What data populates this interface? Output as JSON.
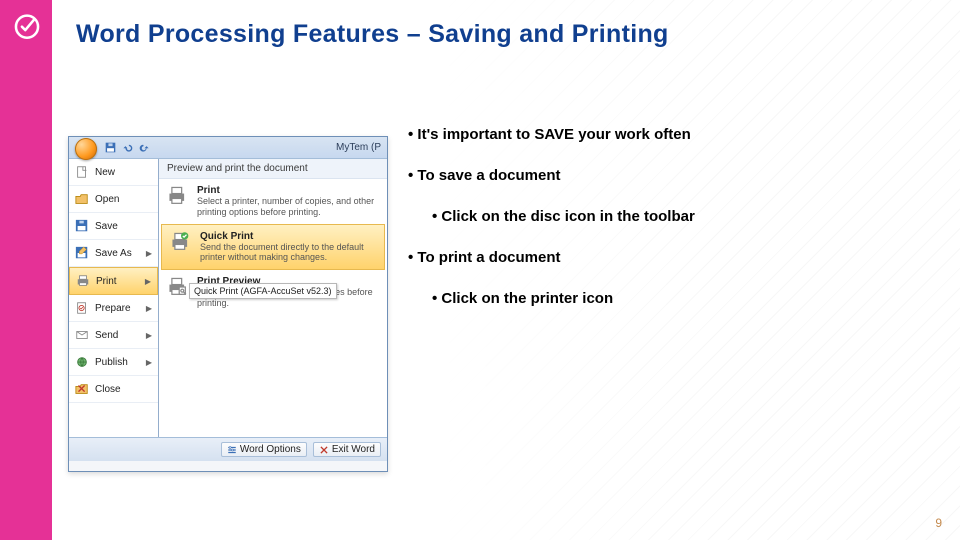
{
  "title": "Word Processing Features – Saving and Printing",
  "slide_number": "9",
  "bullets": {
    "b1": "It's important to SAVE your work often",
    "b2": "To save a document",
    "b2a": "Click on the disc icon in the toolbar",
    "b3": "To print a document",
    "b3a": "Click on the printer icon"
  },
  "office": {
    "doc_name": "MyTem (P",
    "left_menu": [
      {
        "label": "New",
        "icon": "new"
      },
      {
        "label": "Open",
        "icon": "open"
      },
      {
        "label": "Save",
        "icon": "save"
      },
      {
        "label": "Save As",
        "icon": "saveas"
      },
      {
        "label": "Print",
        "icon": "print",
        "selected": true
      },
      {
        "label": "Prepare",
        "icon": "prepare"
      },
      {
        "label": "Send",
        "icon": "send"
      },
      {
        "label": "Publish",
        "icon": "publish"
      },
      {
        "label": "Close",
        "icon": "close"
      }
    ],
    "right_header": "Preview and print the document",
    "right_items": [
      {
        "title": "Print",
        "desc": "Select a printer, number of copies, and other printing options before printing."
      },
      {
        "title": "Quick Print",
        "desc": "Send the document directly to the default printer without making changes.",
        "highlight": true
      },
      {
        "title": "Print Preview",
        "desc": "Preview and make changes to pages before printing."
      }
    ],
    "tooltip": "Quick Print (AGFA-AccuSet v52.3)",
    "footer": {
      "options": "Word Options",
      "exit": "Exit Word"
    }
  }
}
